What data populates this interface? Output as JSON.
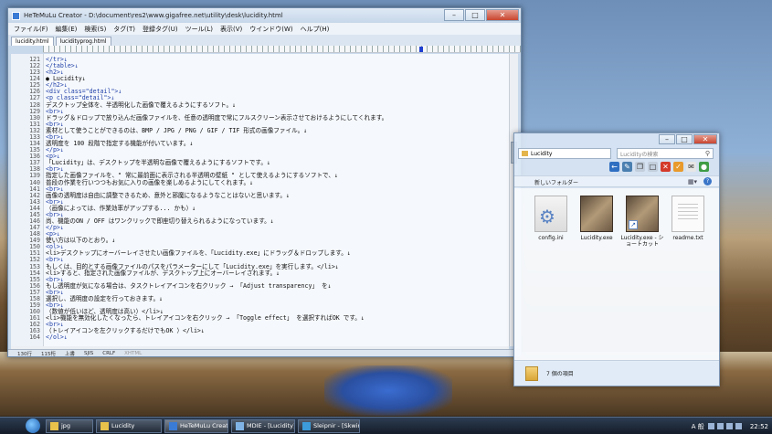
{
  "editor": {
    "title": "HeTeMuLu Creator - D:\\document\\res2\\www.gigafree.net\\utility\\desk\\lucidity.html",
    "menu": [
      "ファイル(F)",
      "編集(E)",
      "検索(S)",
      "タグ(T)",
      "登録タグ(U)",
      "ツール(L)",
      "表示(V)",
      "ウインドウ(W)",
      "ヘルプ(H)"
    ],
    "tabs": [
      "lucidity.html",
      "lucidityprog.html"
    ],
    "lines": [
      {
        "n": "121",
        "t": "</tr>↓",
        "tag": true
      },
      {
        "n": "122",
        "t": "</table>↓",
        "tag": true
      },
      {
        "n": "123",
        "t": "<h2>↓",
        "tag": true
      },
      {
        "n": "124",
        "t": "● Lucidity↓",
        "tag": false
      },
      {
        "n": "125",
        "t": "</h2>↓",
        "tag": true
      },
      {
        "n": "126",
        "t": "<div class=\"detail\">↓",
        "tag": true
      },
      {
        "n": "127",
        "t": "<p class=\"detail\">↓",
        "tag": true
      },
      {
        "n": "128",
        "t": "デスクトップ全体を、半透明化した画像で覆えるようにするソフト。↓",
        "tag": false
      },
      {
        "n": "129",
        "t": "<br>↓",
        "tag": true
      },
      {
        "n": "130",
        "t": "ドラッグ＆ドロップで放り込んだ画像ファイルを、任意の透明度で常にフルスクリーン表示させておけるようにしてくれます。",
        "tag": false
      },
      {
        "n": "131",
        "t": "<br>↓",
        "tag": true
      },
      {
        "n": "132",
        "t": "素材として使うことができるのは、BMP / JPG / PNG / GIF / TIF 形式の画像ファイル。↓",
        "tag": false
      },
      {
        "n": "133",
        "t": "<br>↓",
        "tag": true
      },
      {
        "n": "134",
        "t": "透明度を 100 段階で指定する機能が付いています。↓",
        "tag": false
      },
      {
        "n": "135",
        "t": "</p>↓",
        "tag": true
      },
      {
        "n": "136",
        "t": "<p>↓",
        "tag": true
      },
      {
        "n": "137",
        "t": "「Lucidity」は、デスクトップを半透明な画像で覆えるようにするソフトです。↓",
        "tag": false
      },
      {
        "n": "138",
        "t": "<br>↓",
        "tag": true
      },
      {
        "n": "139",
        "t": "指定した画像ファイルを、\" 常に最前面に表示される半透明の壁紙 \" として使えるようにするソフトで、↓",
        "tag": false
      },
      {
        "n": "140",
        "t": "普段の作業を行いつつもお気に入りの画像を楽しめるようにしてくれます。↓",
        "tag": false
      },
      {
        "n": "141",
        "t": "<br>↓",
        "tag": true
      },
      {
        "n": "142",
        "t": "画像の透明度は自由に調整できるため、意外と邪魔になるようなことはないと思います。↓",
        "tag": false
      },
      {
        "n": "143",
        "t": "<br>↓",
        "tag": true
      },
      {
        "n": "144",
        "t": "（画像によっては、作業効率がアップする... かも）↓",
        "tag": false
      },
      {
        "n": "145",
        "t": "<br>↓",
        "tag": true
      },
      {
        "n": "146",
        "t": "尚、機能のON / OFF はワンクリックで即座切り替えられるようになっています。↓",
        "tag": false
      },
      {
        "n": "147",
        "t": "</p>↓",
        "tag": true
      },
      {
        "n": "148",
        "t": "<p>↓",
        "tag": true
      },
      {
        "n": "149",
        "t": "使い方は以下のとおり。↓",
        "tag": false
      },
      {
        "n": "150",
        "t": "<ol>↓",
        "tag": true
      },
      {
        "n": "151",
        "t": "<li>デスクトップにオーバーレイさせたい画像ファイルを、「Lucidity.exe」にドラッグ＆ドロップします。↓",
        "tag": false
      },
      {
        "n": "152",
        "t": "<br>↓",
        "tag": true
      },
      {
        "n": "153",
        "t": "もしくは、目的とする画像ファイルのパスをパラメーターにして「Lucidity.exe」を実行します。</li>↓",
        "tag": false
      },
      {
        "n": "154",
        "t": "<li>すると、指定された画像ファイルが、デスクトップ上にオーバーレイされます。↓",
        "tag": false
      },
      {
        "n": "155",
        "t": "<br>↓",
        "tag": true
      },
      {
        "n": "156",
        "t": "もし透明度が気になる場合は、タスクトレイアイコンを右クリック → 「Adjust transparency」 を↓",
        "tag": false
      },
      {
        "n": "157",
        "t": "<br>↓",
        "tag": true
      },
      {
        "n": "158",
        "t": "選択し、透明度の設定を行っておきます。↓",
        "tag": false
      },
      {
        "n": "159",
        "t": "<br>↓",
        "tag": true
      },
      {
        "n": "160",
        "t": "（数値が低いほど、透明度は高い）</li>↓",
        "tag": false
      },
      {
        "n": "161",
        "t": "<li>機能を無効化したくなったら、トレイアイコンを右クリック → 「Toggle effect」 を選択すればOK です。↓",
        "tag": false
      },
      {
        "n": "162",
        "t": "<br>↓",
        "tag": true
      },
      {
        "n": "163",
        "t": "（トレイアイコンを左クリックするだけでもOK ）</li>↓",
        "tag": false
      },
      {
        "n": "164",
        "t": "</ol>↓",
        "tag": true
      }
    ],
    "status": {
      "row": "130行",
      "col": "115桁",
      "mode": "上書",
      "enc": "SJIS",
      "eol": "CRLF",
      "type": "XHTML"
    }
  },
  "explorer": {
    "title": "Lucidity",
    "address": "Lucidity",
    "search_placeholder": "Lucidityの検索",
    "new_folder": "新しいフォルダー",
    "files": [
      {
        "name": "config.ini",
        "icon": "config-file-icon"
      },
      {
        "name": "Lucidity.exe",
        "icon": "exe-file-icon"
      },
      {
        "name": "Lucidity.exe - ショートカット",
        "icon": "shortcut-file-icon"
      },
      {
        "name": "readme.txt",
        "icon": "text-file-icon"
      }
    ],
    "item_count": "7 個の項目"
  },
  "taskbar": {
    "buttons": [
      "jpg",
      "Lucidity",
      "HeTeMuLu Creator...",
      "MDIE - [Lucidity]",
      "Sleipnir - [Skwire ..."
    ],
    "active": "HeTeMuLu Creator...",
    "ime": "A 般",
    "clock": "22:52"
  }
}
